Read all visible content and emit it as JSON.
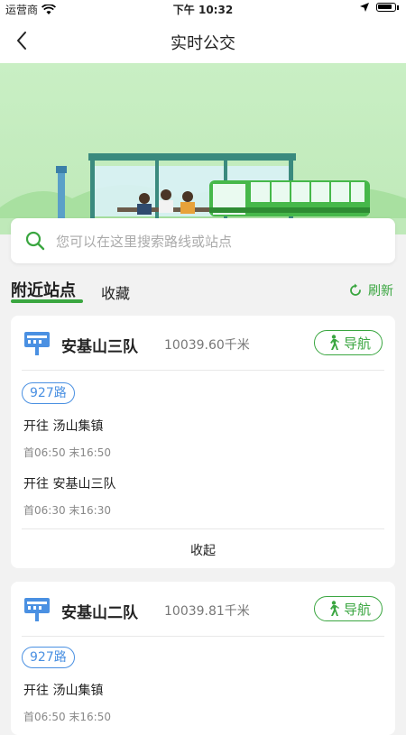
{
  "status_bar": {
    "carrier": "运营商",
    "time": "下午 10:32"
  },
  "nav": {
    "title": "实时公交"
  },
  "search": {
    "placeholder": "您可以在这里搜索路线或站点"
  },
  "tabs": {
    "nearby": "附近站点",
    "favorites": "收藏",
    "refresh": "刷新"
  },
  "stops": [
    {
      "name": "安基山三队",
      "distance": "10039.60千米",
      "nav_label": "导航",
      "route": "927路",
      "directions": [
        {
          "to": "开往 汤山集镇",
          "times": "首06:50 末16:50"
        },
        {
          "to": "开往 安基山三队",
          "times": "首06:30 末16:30"
        }
      ],
      "collapse": "收起"
    },
    {
      "name": "安基山二队",
      "distance": "10039.81千米",
      "nav_label": "导航",
      "route": "927路",
      "directions": [
        {
          "to": "开往 汤山集镇",
          "times": "首06:50 末16:50"
        }
      ]
    }
  ],
  "colors": {
    "accent": "#3aa640",
    "route_blue": "#4a90e2",
    "banner_bg": "#c9efc4"
  }
}
